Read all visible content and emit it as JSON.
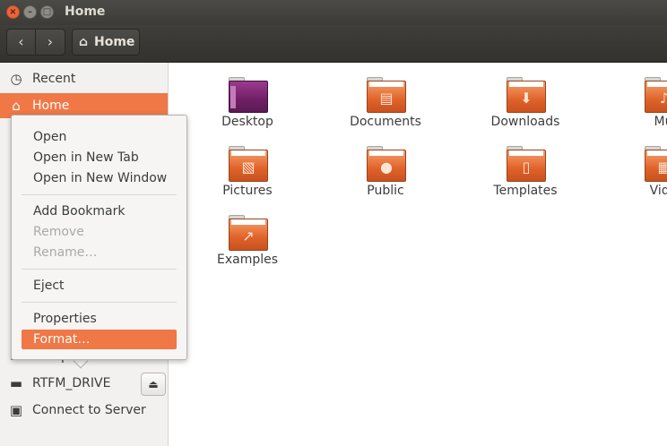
{
  "window": {
    "title": "Home",
    "close_glyph": "×",
    "minimize_glyph": "–",
    "maximize_glyph": "□"
  },
  "toolbar": {
    "back_glyph": "‹",
    "forward_glyph": "›",
    "path_icon": "⌂",
    "path_label": "Home"
  },
  "sidebar": {
    "items": [
      {
        "label": "Recent",
        "icon": "clock-icon",
        "glyph": "◷"
      },
      {
        "label": "Home",
        "icon": "home-icon",
        "glyph": "⌂"
      },
      {
        "label": "Comp",
        "icon": "computer-icon",
        "glyph": "▭"
      },
      {
        "label": "RTFM_DRIVE",
        "icon": "drive-icon",
        "glyph": "▬"
      },
      {
        "label": "Connect to Server",
        "icon": "server-icon",
        "glyph": "▣"
      }
    ],
    "eject_glyph": "⏏"
  },
  "files": [
    {
      "label": "Desktop",
      "emblem": ""
    },
    {
      "label": "Documents",
      "emblem": "▤"
    },
    {
      "label": "Downloads",
      "emblem": "⬇"
    },
    {
      "label": "Mu",
      "emblem": "♪"
    },
    {
      "label": "Pictures",
      "emblem": "▧"
    },
    {
      "label": "Public",
      "emblem": "●"
    },
    {
      "label": "Templates",
      "emblem": "▯"
    },
    {
      "label": "Vide",
      "emblem": "▦"
    },
    {
      "label": "Examples",
      "emblem": "↗"
    }
  ],
  "context_menu": {
    "items": [
      {
        "label": "Open",
        "state": "enabled"
      },
      {
        "label": "Open in New Tab",
        "state": "enabled"
      },
      {
        "label": "Open in New Window",
        "state": "enabled"
      },
      {
        "label": "Add Bookmark",
        "state": "enabled"
      },
      {
        "label": "Remove",
        "state": "disabled"
      },
      {
        "label": "Rename…",
        "state": "disabled"
      },
      {
        "label": "Eject",
        "state": "enabled"
      },
      {
        "label": "Properties",
        "state": "enabled"
      },
      {
        "label": "Format…",
        "state": "highlighted"
      }
    ]
  },
  "colors": {
    "accent": "#f07746",
    "titlebar": "#3c3b37",
    "sidebar_bg": "#f2f1f0"
  }
}
